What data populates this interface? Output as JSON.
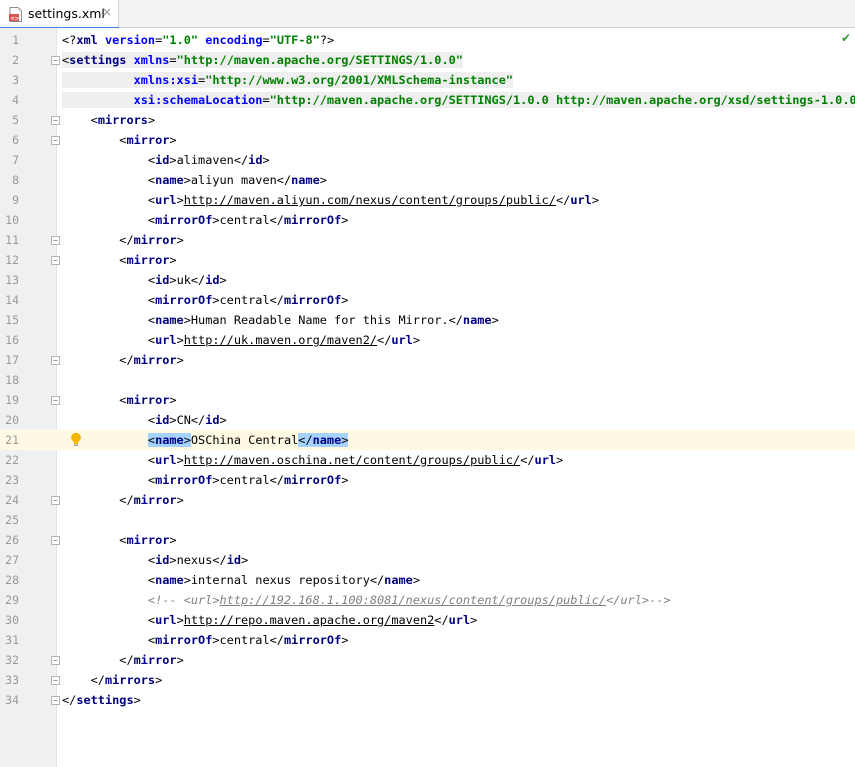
{
  "tab": {
    "filename": "settings.xml",
    "close_glyph": "×",
    "icon": "xml-file-icon"
  },
  "status": {
    "check_glyph": "✔"
  },
  "editor": {
    "highlighted_line": 21,
    "lines": [
      {
        "n": "1",
        "segs": [
          [
            "p",
            "<?"
          ],
          [
            "kw",
            "xml "
          ],
          [
            "attr",
            "version"
          ],
          [
            "p",
            "="
          ],
          [
            "str",
            "\"1.0\""
          ],
          [
            "p",
            " "
          ],
          [
            "attr",
            "encoding"
          ],
          [
            "p",
            "="
          ],
          [
            "str",
            "\"UTF-8\""
          ],
          [
            "p",
            "?>"
          ]
        ]
      },
      {
        "n": "2",
        "shade": true,
        "segs": [
          [
            "p",
            "<"
          ],
          [
            "kw",
            "settings "
          ],
          [
            "attr",
            "xmlns"
          ],
          [
            "p",
            "="
          ],
          [
            "str",
            "\"http://maven.apache.org/SETTINGS/1.0.0\""
          ]
        ]
      },
      {
        "n": "3",
        "shade": true,
        "segs": [
          [
            "p",
            "          "
          ],
          [
            "attr",
            "xmlns:xsi"
          ],
          [
            "p",
            "="
          ],
          [
            "str",
            "\"http://www.w3.org/2001/XMLSchema-instance\""
          ]
        ]
      },
      {
        "n": "4",
        "shade": true,
        "segs": [
          [
            "p",
            "          "
          ],
          [
            "attr",
            "xsi:schemaLocation"
          ],
          [
            "p",
            "="
          ],
          [
            "str",
            "\"http://maven.apache.org/SETTINGS/1.0.0 http://maven.apache.org/xsd/settings-1.0.0.x"
          ]
        ]
      },
      {
        "n": "5",
        "segs": [
          [
            "p",
            "    "
          ],
          [
            "p",
            "<"
          ],
          [
            "kw",
            "mirrors"
          ],
          [
            "p",
            ">"
          ]
        ]
      },
      {
        "n": "6",
        "segs": [
          [
            "p",
            "        "
          ],
          [
            "p",
            "<"
          ],
          [
            "kw",
            "mirror"
          ],
          [
            "p",
            ">"
          ]
        ]
      },
      {
        "n": "7",
        "segs": [
          [
            "p",
            "            "
          ],
          [
            "p",
            "<"
          ],
          [
            "kw",
            "id"
          ],
          [
            "p",
            ">alimaven</"
          ],
          [
            "kw",
            "id"
          ],
          [
            "p",
            ">"
          ]
        ]
      },
      {
        "n": "8",
        "segs": [
          [
            "p",
            "            "
          ],
          [
            "p",
            "<"
          ],
          [
            "kw",
            "name"
          ],
          [
            "p",
            ">aliyun maven</"
          ],
          [
            "kw",
            "name"
          ],
          [
            "p",
            ">"
          ]
        ]
      },
      {
        "n": "9",
        "segs": [
          [
            "p",
            "            "
          ],
          [
            "p",
            "<"
          ],
          [
            "kw",
            "url"
          ],
          [
            "p",
            ">"
          ],
          [
            "lnk",
            "http://maven.aliyun.com/nexus/content/groups/public/"
          ],
          [
            "p",
            "</"
          ],
          [
            "kw",
            "url"
          ],
          [
            "p",
            ">"
          ]
        ]
      },
      {
        "n": "10",
        "segs": [
          [
            "p",
            "            "
          ],
          [
            "p",
            "<"
          ],
          [
            "kw",
            "mirrorOf"
          ],
          [
            "p",
            ">central</"
          ],
          [
            "kw",
            "mirrorOf"
          ],
          [
            "p",
            ">"
          ]
        ]
      },
      {
        "n": "11",
        "segs": [
          [
            "p",
            "        "
          ],
          [
            "p",
            "</"
          ],
          [
            "kw",
            "mirror"
          ],
          [
            "p",
            ">"
          ]
        ]
      },
      {
        "n": "12",
        "segs": [
          [
            "p",
            "        "
          ],
          [
            "p",
            "<"
          ],
          [
            "kw",
            "mirror"
          ],
          [
            "p",
            ">"
          ]
        ]
      },
      {
        "n": "13",
        "segs": [
          [
            "p",
            "            "
          ],
          [
            "p",
            "<"
          ],
          [
            "kw",
            "id"
          ],
          [
            "p",
            ">uk</"
          ],
          [
            "kw",
            "id"
          ],
          [
            "p",
            ">"
          ]
        ]
      },
      {
        "n": "14",
        "segs": [
          [
            "p",
            "            "
          ],
          [
            "p",
            "<"
          ],
          [
            "kw",
            "mirrorOf"
          ],
          [
            "p",
            ">central</"
          ],
          [
            "kw",
            "mirrorOf"
          ],
          [
            "p",
            ">"
          ]
        ]
      },
      {
        "n": "15",
        "segs": [
          [
            "p",
            "            "
          ],
          [
            "p",
            "<"
          ],
          [
            "kw",
            "name"
          ],
          [
            "p",
            ">Human Readable Name for this Mirror.</"
          ],
          [
            "kw",
            "name"
          ],
          [
            "p",
            ">"
          ]
        ]
      },
      {
        "n": "16",
        "segs": [
          [
            "p",
            "            "
          ],
          [
            "p",
            "<"
          ],
          [
            "kw",
            "url"
          ],
          [
            "p",
            ">"
          ],
          [
            "lnk",
            "http://uk.maven.org/maven2/"
          ],
          [
            "p",
            "</"
          ],
          [
            "kw",
            "url"
          ],
          [
            "p",
            ">"
          ]
        ]
      },
      {
        "n": "17",
        "segs": [
          [
            "p",
            "        "
          ],
          [
            "p",
            "</"
          ],
          [
            "kw",
            "mirror"
          ],
          [
            "p",
            ">"
          ]
        ]
      },
      {
        "n": "18",
        "segs": []
      },
      {
        "n": "19",
        "segs": [
          [
            "p",
            "        "
          ],
          [
            "p",
            "<"
          ],
          [
            "kw",
            "mirror"
          ],
          [
            "p",
            ">"
          ]
        ]
      },
      {
        "n": "20",
        "segs": [
          [
            "p",
            "            "
          ],
          [
            "p",
            "<"
          ],
          [
            "kw",
            "id"
          ],
          [
            "p",
            ">CN</"
          ],
          [
            "kw",
            "id"
          ],
          [
            "p",
            ">"
          ]
        ]
      },
      {
        "n": "21",
        "segs": [
          [
            "p",
            "            "
          ],
          [
            "sel",
            "<"
          ],
          [
            "selkw",
            "name"
          ],
          [
            "sel",
            ">"
          ],
          [
            "p",
            "OSChina Central"
          ],
          [
            "sel",
            "</"
          ],
          [
            "selkw",
            "name"
          ],
          [
            "sel",
            ">"
          ]
        ]
      },
      {
        "n": "22",
        "segs": [
          [
            "p",
            "            "
          ],
          [
            "p",
            "<"
          ],
          [
            "kw",
            "url"
          ],
          [
            "p",
            ">"
          ],
          [
            "lnk",
            "http://maven.oschina.net/content/groups/public/"
          ],
          [
            "p",
            "</"
          ],
          [
            "kw",
            "url"
          ],
          [
            "p",
            ">"
          ]
        ]
      },
      {
        "n": "23",
        "segs": [
          [
            "p",
            "            "
          ],
          [
            "p",
            "<"
          ],
          [
            "kw",
            "mirrorOf"
          ],
          [
            "p",
            ">central</"
          ],
          [
            "kw",
            "mirrorOf"
          ],
          [
            "p",
            ">"
          ]
        ]
      },
      {
        "n": "24",
        "segs": [
          [
            "p",
            "        "
          ],
          [
            "p",
            "</"
          ],
          [
            "kw",
            "mirror"
          ],
          [
            "p",
            ">"
          ]
        ]
      },
      {
        "n": "25",
        "segs": []
      },
      {
        "n": "26",
        "segs": [
          [
            "p",
            "        "
          ],
          [
            "p",
            "<"
          ],
          [
            "kw",
            "mirror"
          ],
          [
            "p",
            ">"
          ]
        ]
      },
      {
        "n": "27",
        "segs": [
          [
            "p",
            "            "
          ],
          [
            "p",
            "<"
          ],
          [
            "kw",
            "id"
          ],
          [
            "p",
            ">nexus</"
          ],
          [
            "kw",
            "id"
          ],
          [
            "p",
            ">"
          ]
        ]
      },
      {
        "n": "28",
        "segs": [
          [
            "p",
            "            "
          ],
          [
            "p",
            "<"
          ],
          [
            "kw",
            "name"
          ],
          [
            "p",
            ">internal nexus repository</"
          ],
          [
            "kw",
            "name"
          ],
          [
            "p",
            ">"
          ]
        ]
      },
      {
        "n": "29",
        "segs": [
          [
            "p",
            "            "
          ],
          [
            "cmt",
            "<!-- <url>"
          ],
          [
            "cmtlnk",
            "http://192.168.1.100:8081/nexus/content/groups/public/"
          ],
          [
            "cmt",
            "</url>-->"
          ]
        ]
      },
      {
        "n": "30",
        "segs": [
          [
            "p",
            "            "
          ],
          [
            "p",
            "<"
          ],
          [
            "kw",
            "url"
          ],
          [
            "p",
            ">"
          ],
          [
            "lnk",
            "http://repo.maven.apache.org/maven2"
          ],
          [
            "p",
            "</"
          ],
          [
            "kw",
            "url"
          ],
          [
            "p",
            ">"
          ]
        ]
      },
      {
        "n": "31",
        "segs": [
          [
            "p",
            "            "
          ],
          [
            "p",
            "<"
          ],
          [
            "kw",
            "mirrorOf"
          ],
          [
            "p",
            ">central</"
          ],
          [
            "kw",
            "mirrorOf"
          ],
          [
            "p",
            ">"
          ]
        ]
      },
      {
        "n": "32",
        "segs": [
          [
            "p",
            "        "
          ],
          [
            "p",
            "</"
          ],
          [
            "kw",
            "mirror"
          ],
          [
            "p",
            ">"
          ]
        ]
      },
      {
        "n": "33",
        "segs": [
          [
            "p",
            "    "
          ],
          [
            "p",
            "</"
          ],
          [
            "kw",
            "mirrors"
          ],
          [
            "p",
            ">"
          ]
        ]
      },
      {
        "n": "34",
        "segs": [
          [
            "p",
            "</"
          ],
          [
            "kw",
            "settings"
          ],
          [
            "p",
            ">"
          ]
        ]
      }
    ]
  }
}
